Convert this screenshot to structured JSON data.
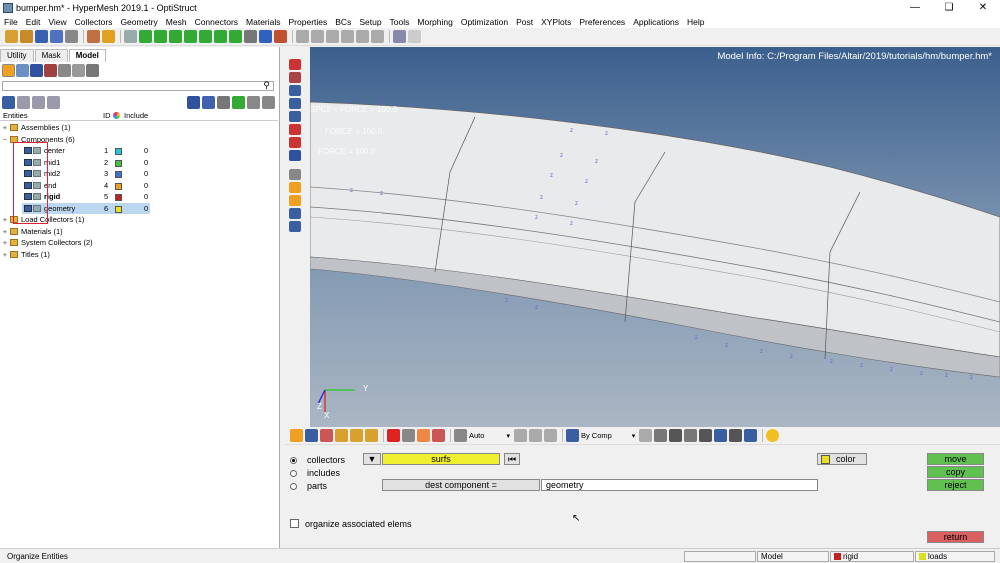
{
  "window": {
    "title": "bumper.hm* - HyperMesh 2019.1 - OptiStruct",
    "controls": [
      "—",
      "❏",
      "✕"
    ]
  },
  "menu": [
    "File",
    "Edit",
    "View",
    "Collectors",
    "Geometry",
    "Mesh",
    "Connectors",
    "Materials",
    "Properties",
    "BCs",
    "Setup",
    "Tools",
    "Morphing",
    "Optimization",
    "Post",
    "XYPlots",
    "Preferences",
    "Applications",
    "Help"
  ],
  "browser": {
    "tabs": [
      "Utility",
      "Mask",
      "Model"
    ],
    "active_tab": "Model",
    "columns": {
      "entities": "Entities",
      "id": "ID",
      "include": "Include"
    },
    "tree": [
      {
        "label": "Assemblies (1)",
        "level": 0,
        "expander": "+",
        "icon": "folder-icon"
      },
      {
        "label": "Components (6)",
        "level": 0,
        "expander": "−",
        "icon": "folder-icon"
      },
      {
        "label": "center",
        "level": 1,
        "id": "1",
        "color": "#22c7d9",
        "include": "0"
      },
      {
        "label": "mid1",
        "level": 1,
        "id": "2",
        "color": "#3ec43e",
        "include": "0"
      },
      {
        "label": "mid2",
        "level": 1,
        "id": "3",
        "color": "#3a6fd8",
        "include": "0"
      },
      {
        "label": "end",
        "level": 1,
        "id": "4",
        "color": "#f0a020",
        "include": "0"
      },
      {
        "label": "rigid",
        "level": 1,
        "id": "5",
        "color": "#c02020",
        "include": "0",
        "bold": true
      },
      {
        "label": "geometry",
        "level": 1,
        "id": "6",
        "color": "#e8e020",
        "include": "0",
        "selected": true
      },
      {
        "label": "Load Collectors (1)",
        "level": 0,
        "expander": "+",
        "icon": "folder-icon"
      },
      {
        "label": "Materials (1)",
        "level": 0,
        "expander": "+",
        "icon": "folder-icon"
      },
      {
        "label": "System Collectors (2)",
        "level": 0,
        "expander": "+",
        "icon": "folder-icon"
      },
      {
        "label": "Titles (1)",
        "level": 0,
        "expander": "+",
        "icon": "folder-icon"
      }
    ]
  },
  "viewport": {
    "model_info": "Model Info: C:/Program Files/Altair/2019/tutorials/hm/bumper.hm*",
    "labels": [
      "SPC2 = FORCE = 100.0",
      "FORCE = 100.0",
      "FORCE = 100.0"
    ],
    "triad": {
      "x": "X",
      "y": "Y",
      "z": "Z"
    }
  },
  "bottom_toolbar": {
    "auto_label": "Auto",
    "by_comp_label": "By Comp"
  },
  "panel": {
    "radios": [
      {
        "label": "collectors",
        "selected": true
      },
      {
        "label": "includes",
        "selected": false
      },
      {
        "label": "parts",
        "selected": false
      }
    ],
    "entity_selector": "surfs",
    "dest_button": "dest component =",
    "dest_value": "geometry",
    "color_button": "color",
    "checkbox_label": "organize associated elems",
    "actions": {
      "move": "move",
      "copy": "copy",
      "reject": "reject",
      "return": "return"
    }
  },
  "status": {
    "left": "Organize Entities",
    "model": "Model",
    "comp": "rigid",
    "loads": "loads"
  }
}
